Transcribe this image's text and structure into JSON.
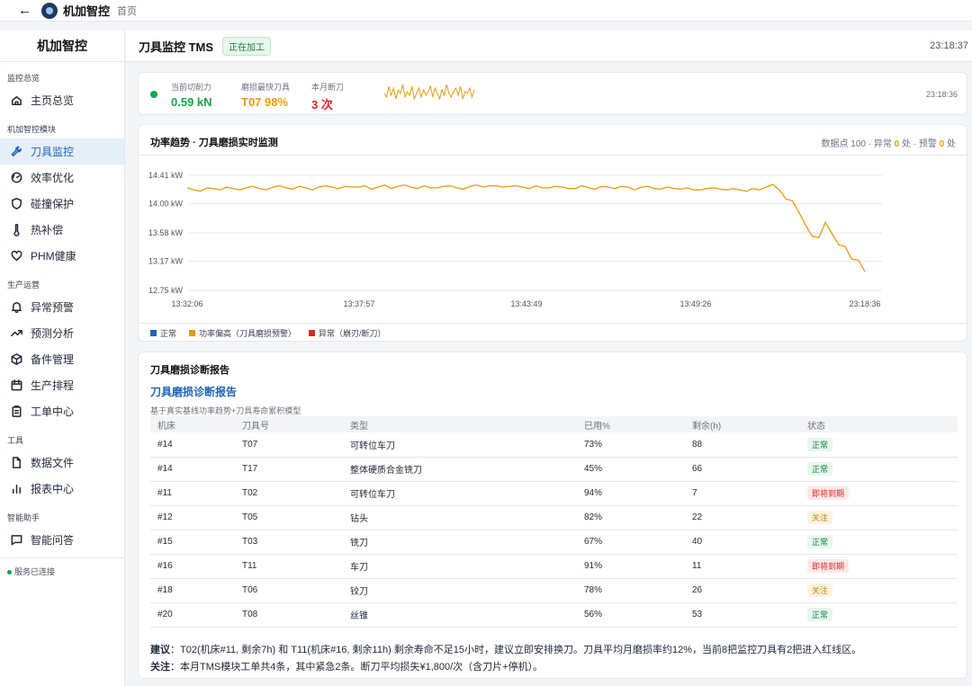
{
  "topbar": {
    "brand": "机加智控",
    "crumb": "首页"
  },
  "sidebar": {
    "title": "机加智控",
    "groups": [
      {
        "label": "监控总览",
        "items": [
          {
            "label": "主页总览",
            "icon": "home-icon"
          }
        ]
      },
      {
        "label": "机加智控模块",
        "items": [
          {
            "label": "刀具监控",
            "icon": "wrench-icon"
          },
          {
            "label": "效率优化",
            "icon": "gauge-icon"
          },
          {
            "label": "碰撞保护",
            "icon": "shield-icon"
          },
          {
            "label": "热补偿",
            "icon": "thermometer-icon"
          },
          {
            "label": "PHM健康",
            "icon": "heart-icon"
          }
        ]
      },
      {
        "label": "生产运营",
        "items": [
          {
            "label": "异常预警",
            "icon": "bell-icon"
          },
          {
            "label": "预测分析",
            "icon": "trend-icon"
          },
          {
            "label": "备件管理",
            "icon": "box-icon"
          },
          {
            "label": "生产排程",
            "icon": "calendar-icon"
          },
          {
            "label": "工单中心",
            "icon": "clipboard-icon"
          }
        ]
      },
      {
        "label": "工具",
        "items": [
          {
            "label": "数据文件",
            "icon": "file-icon"
          },
          {
            "label": "报表中心",
            "icon": "bar-chart-icon"
          }
        ]
      },
      {
        "label": "智能助手",
        "items": [
          {
            "label": "智能问答",
            "icon": "chat-icon"
          }
        ]
      }
    ],
    "status": "服务已连接"
  },
  "header": {
    "title": "刀具监控 TMS",
    "badge": "正在加工",
    "time": "23:18:37"
  },
  "kpi": {
    "items": [
      {
        "label": "当前切削力",
        "value": "0.59 kN",
        "color": "#16a34a"
      },
      {
        "label": "磨损最快刀具",
        "value": "T07 98%",
        "color": "#e69b10"
      },
      {
        "label": "本月断刀",
        "value": "3 次",
        "color": "#dc2626"
      }
    ],
    "time": "23:18:36",
    "spark_values": [
      0.5,
      0.3,
      0.9,
      0.4,
      0.8,
      0.2,
      0.7,
      0.5,
      1.0,
      0.3,
      0.6,
      0.4,
      0.9,
      0.2,
      0.5,
      0.8,
      0.3,
      0.7,
      0.4,
      0.6,
      0.9,
      0.3,
      0.8,
      0.5,
      0.2,
      0.7,
      0.4,
      1.0,
      0.5,
      0.3,
      0.6,
      0.8,
      0.4,
      0.9,
      0.2,
      0.6,
      0.5,
      0.8,
      0.3,
      0.7
    ]
  },
  "chart": {
    "title": "功率趋势 · 刀具磨损实时监测",
    "stats_prefix": "数据点 100 · 异常",
    "stats_abn": "0",
    "stats_mid": "处 · 预警",
    "stats_warn": "0",
    "stats_suffix": "处",
    "legend": [
      {
        "label": "正常",
        "color": "#1e63b8"
      },
      {
        "label": "功率偏高（刀具磨损预警）",
        "color": "#e69b10"
      },
      {
        "label": "异常（崩刃/断刀）",
        "color": "#dc2626"
      }
    ]
  },
  "chart_data": {
    "type": "line",
    "ylim": [
      12.75,
      14.41
    ],
    "y_ticks": [
      "14.41 kW",
      "14.00 kW",
      "13.58 kW",
      "13.17 kW",
      "12.75 kW"
    ],
    "y_tick_values": [
      14.41,
      14.0,
      13.58,
      13.17,
      12.75
    ],
    "x_ticks": [
      "13:32:06",
      "13:37:57",
      "13:43:49",
      "13:49:26",
      "23:18:36"
    ],
    "series": [
      {
        "color": "#e69b10",
        "values": [
          14.23,
          14.2,
          14.18,
          14.23,
          14.22,
          14.2,
          14.24,
          14.22,
          14.2,
          14.23,
          14.25,
          14.22,
          14.2,
          14.24,
          14.26,
          14.23,
          14.21,
          14.25,
          14.23,
          14.2,
          14.24,
          14.26,
          14.24,
          14.22,
          14.25,
          14.24,
          14.24,
          14.26,
          14.21,
          14.24,
          14.27,
          14.22,
          14.25,
          14.27,
          14.24,
          14.22,
          14.26,
          14.23,
          14.23,
          14.25,
          14.26,
          14.23,
          14.21,
          14.25,
          14.27,
          14.24,
          14.26,
          14.26,
          14.24,
          14.25,
          14.26,
          14.24,
          14.22,
          14.26,
          14.23,
          14.23,
          14.25,
          14.24,
          14.22,
          14.22,
          14.26,
          14.23,
          14.21,
          14.25,
          14.24,
          14.22,
          14.25,
          14.24,
          14.2,
          14.24,
          14.25,
          14.22,
          14.21,
          14.24,
          14.22,
          14.21,
          14.23,
          14.2,
          14.2,
          14.22,
          14.23,
          14.21,
          14.2,
          14.22,
          14.2,
          14.18,
          14.22,
          14.2,
          14.24,
          14.28,
          14.2,
          14.07,
          14.04,
          13.87,
          13.69,
          13.53,
          13.51,
          13.73,
          13.57,
          13.41,
          13.38,
          13.2,
          13.19,
          13.02
        ]
      }
    ]
  },
  "report": {
    "title": "刀具磨损诊断报告",
    "subtitle": "刀具磨损诊断报告",
    "desc": "基于真实基线功率趋势+刀具寿命累积模型",
    "columns": [
      "机床",
      "刀具号",
      "类型",
      "已用%",
      "剩余(h)",
      "状态"
    ],
    "rows": [
      {
        "machine": "#14",
        "tool": "T07",
        "type": "可转位车刀",
        "used": "73%",
        "remain": "88",
        "status": "正常",
        "level": "ok"
      },
      {
        "machine": "#14",
        "tool": "T17",
        "type": "整体硬质合金铣刀",
        "used": "45%",
        "remain": "66",
        "status": "正常",
        "level": "ok"
      },
      {
        "machine": "#11",
        "tool": "T02",
        "type": "可转位车刀",
        "used": "94%",
        "remain": "7",
        "status": "即将到期",
        "level": "bad"
      },
      {
        "machine": "#12",
        "tool": "T05",
        "type": "钻头",
        "used": "82%",
        "remain": "22",
        "status": "关注",
        "level": "warn"
      },
      {
        "machine": "#15",
        "tool": "T03",
        "type": "铣刀",
        "used": "67%",
        "remain": "40",
        "status": "正常",
        "level": "ok"
      },
      {
        "machine": "#16",
        "tool": "T11",
        "type": "车刀",
        "used": "91%",
        "remain": "11",
        "status": "即将到期",
        "level": "bad"
      },
      {
        "machine": "#18",
        "tool": "T06",
        "type": "铰刀",
        "used": "78%",
        "remain": "26",
        "status": "关注",
        "level": "warn"
      },
      {
        "machine": "#20",
        "tool": "T08",
        "type": "丝锥",
        "used": "56%",
        "remain": "53",
        "status": "正常",
        "level": "ok"
      }
    ],
    "advice_label": "建议",
    "advice": "：T02(机床#11, 剩余7h) 和 T11(机床#16, 剩余11h) 剩余寿命不足15小时，建议立即安排换刀。刀具平均月磨损率约12%，当前8把监控刀具有2把进入红线区。",
    "note_label": "关注",
    "note": "：本月TMS模块工单共4条，其中紧急2条。断刀平均损失¥1,800/次（含刀片+停机）。"
  }
}
